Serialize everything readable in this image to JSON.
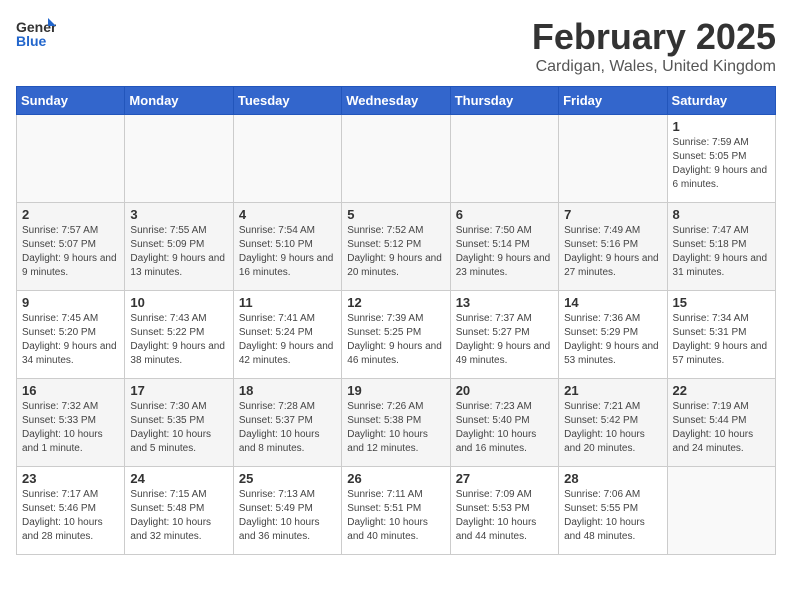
{
  "header": {
    "logo_general": "General",
    "logo_blue": "Blue",
    "title": "February 2025",
    "subtitle": "Cardigan, Wales, United Kingdom"
  },
  "days_of_week": [
    "Sunday",
    "Monday",
    "Tuesday",
    "Wednesday",
    "Thursday",
    "Friday",
    "Saturday"
  ],
  "weeks": [
    [
      {
        "day": "",
        "info": ""
      },
      {
        "day": "",
        "info": ""
      },
      {
        "day": "",
        "info": ""
      },
      {
        "day": "",
        "info": ""
      },
      {
        "day": "",
        "info": ""
      },
      {
        "day": "",
        "info": ""
      },
      {
        "day": "1",
        "info": "Sunrise: 7:59 AM\nSunset: 5:05 PM\nDaylight: 9 hours and 6 minutes."
      }
    ],
    [
      {
        "day": "2",
        "info": "Sunrise: 7:57 AM\nSunset: 5:07 PM\nDaylight: 9 hours and 9 minutes."
      },
      {
        "day": "3",
        "info": "Sunrise: 7:55 AM\nSunset: 5:09 PM\nDaylight: 9 hours and 13 minutes."
      },
      {
        "day": "4",
        "info": "Sunrise: 7:54 AM\nSunset: 5:10 PM\nDaylight: 9 hours and 16 minutes."
      },
      {
        "day": "5",
        "info": "Sunrise: 7:52 AM\nSunset: 5:12 PM\nDaylight: 9 hours and 20 minutes."
      },
      {
        "day": "6",
        "info": "Sunrise: 7:50 AM\nSunset: 5:14 PM\nDaylight: 9 hours and 23 minutes."
      },
      {
        "day": "7",
        "info": "Sunrise: 7:49 AM\nSunset: 5:16 PM\nDaylight: 9 hours and 27 minutes."
      },
      {
        "day": "8",
        "info": "Sunrise: 7:47 AM\nSunset: 5:18 PM\nDaylight: 9 hours and 31 minutes."
      }
    ],
    [
      {
        "day": "9",
        "info": "Sunrise: 7:45 AM\nSunset: 5:20 PM\nDaylight: 9 hours and 34 minutes."
      },
      {
        "day": "10",
        "info": "Sunrise: 7:43 AM\nSunset: 5:22 PM\nDaylight: 9 hours and 38 minutes."
      },
      {
        "day": "11",
        "info": "Sunrise: 7:41 AM\nSunset: 5:24 PM\nDaylight: 9 hours and 42 minutes."
      },
      {
        "day": "12",
        "info": "Sunrise: 7:39 AM\nSunset: 5:25 PM\nDaylight: 9 hours and 46 minutes."
      },
      {
        "day": "13",
        "info": "Sunrise: 7:37 AM\nSunset: 5:27 PM\nDaylight: 9 hours and 49 minutes."
      },
      {
        "day": "14",
        "info": "Sunrise: 7:36 AM\nSunset: 5:29 PM\nDaylight: 9 hours and 53 minutes."
      },
      {
        "day": "15",
        "info": "Sunrise: 7:34 AM\nSunset: 5:31 PM\nDaylight: 9 hours and 57 minutes."
      }
    ],
    [
      {
        "day": "16",
        "info": "Sunrise: 7:32 AM\nSunset: 5:33 PM\nDaylight: 10 hours and 1 minute."
      },
      {
        "day": "17",
        "info": "Sunrise: 7:30 AM\nSunset: 5:35 PM\nDaylight: 10 hours and 5 minutes."
      },
      {
        "day": "18",
        "info": "Sunrise: 7:28 AM\nSunset: 5:37 PM\nDaylight: 10 hours and 8 minutes."
      },
      {
        "day": "19",
        "info": "Sunrise: 7:26 AM\nSunset: 5:38 PM\nDaylight: 10 hours and 12 minutes."
      },
      {
        "day": "20",
        "info": "Sunrise: 7:23 AM\nSunset: 5:40 PM\nDaylight: 10 hours and 16 minutes."
      },
      {
        "day": "21",
        "info": "Sunrise: 7:21 AM\nSunset: 5:42 PM\nDaylight: 10 hours and 20 minutes."
      },
      {
        "day": "22",
        "info": "Sunrise: 7:19 AM\nSunset: 5:44 PM\nDaylight: 10 hours and 24 minutes."
      }
    ],
    [
      {
        "day": "23",
        "info": "Sunrise: 7:17 AM\nSunset: 5:46 PM\nDaylight: 10 hours and 28 minutes."
      },
      {
        "day": "24",
        "info": "Sunrise: 7:15 AM\nSunset: 5:48 PM\nDaylight: 10 hours and 32 minutes."
      },
      {
        "day": "25",
        "info": "Sunrise: 7:13 AM\nSunset: 5:49 PM\nDaylight: 10 hours and 36 minutes."
      },
      {
        "day": "26",
        "info": "Sunrise: 7:11 AM\nSunset: 5:51 PM\nDaylight: 10 hours and 40 minutes."
      },
      {
        "day": "27",
        "info": "Sunrise: 7:09 AM\nSunset: 5:53 PM\nDaylight: 10 hours and 44 minutes."
      },
      {
        "day": "28",
        "info": "Sunrise: 7:06 AM\nSunset: 5:55 PM\nDaylight: 10 hours and 48 minutes."
      },
      {
        "day": "",
        "info": ""
      }
    ]
  ]
}
